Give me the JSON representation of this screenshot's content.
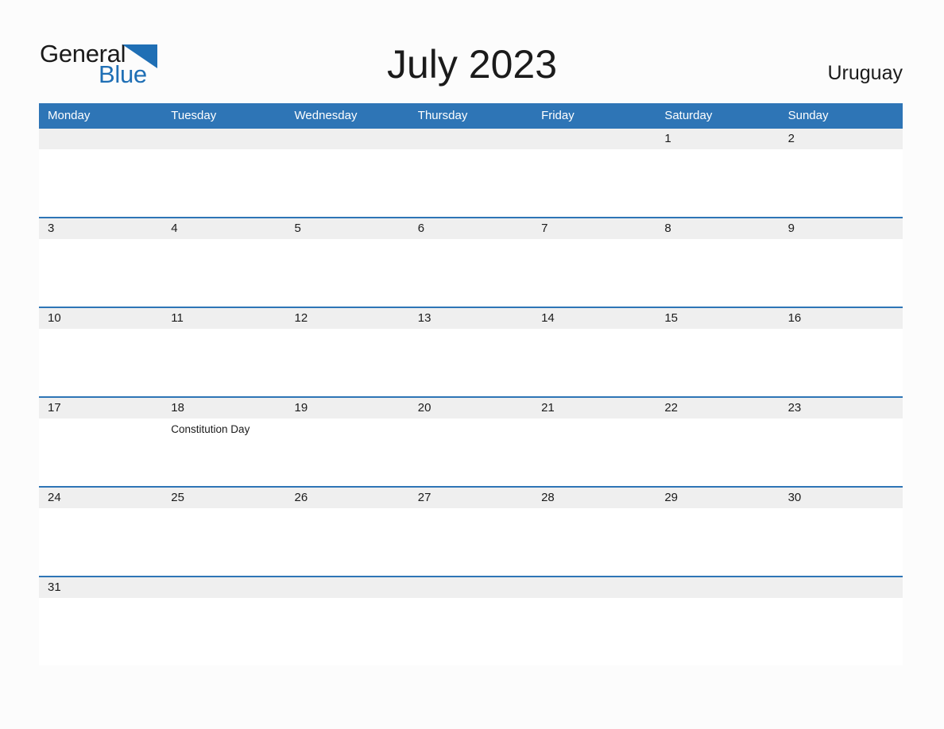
{
  "brand": {
    "name_part1": "General",
    "name_part2": "Blue",
    "triangle_color": "#1f6fb5"
  },
  "header": {
    "title": "July 2023",
    "country": "Uruguay"
  },
  "colors": {
    "header_blue": "#2e75b6",
    "day_band_gray": "#efefef",
    "page_background": "#fcfcfc",
    "text": "#1b1b1b",
    "header_text": "#ffffff"
  },
  "calendar": {
    "weekday_headers": [
      "Monday",
      "Tuesday",
      "Wednesday",
      "Thursday",
      "Friday",
      "Saturday",
      "Sunday"
    ],
    "weeks": [
      {
        "days": [
          {
            "number": "",
            "event": ""
          },
          {
            "number": "",
            "event": ""
          },
          {
            "number": "",
            "event": ""
          },
          {
            "number": "",
            "event": ""
          },
          {
            "number": "",
            "event": ""
          },
          {
            "number": "1",
            "event": ""
          },
          {
            "number": "2",
            "event": ""
          }
        ]
      },
      {
        "days": [
          {
            "number": "3",
            "event": ""
          },
          {
            "number": "4",
            "event": ""
          },
          {
            "number": "5",
            "event": ""
          },
          {
            "number": "6",
            "event": ""
          },
          {
            "number": "7",
            "event": ""
          },
          {
            "number": "8",
            "event": ""
          },
          {
            "number": "9",
            "event": ""
          }
        ]
      },
      {
        "days": [
          {
            "number": "10",
            "event": ""
          },
          {
            "number": "11",
            "event": ""
          },
          {
            "number": "12",
            "event": ""
          },
          {
            "number": "13",
            "event": ""
          },
          {
            "number": "14",
            "event": ""
          },
          {
            "number": "15",
            "event": ""
          },
          {
            "number": "16",
            "event": ""
          }
        ]
      },
      {
        "days": [
          {
            "number": "17",
            "event": ""
          },
          {
            "number": "18",
            "event": "Constitution Day"
          },
          {
            "number": "19",
            "event": ""
          },
          {
            "number": "20",
            "event": ""
          },
          {
            "number": "21",
            "event": ""
          },
          {
            "number": "22",
            "event": ""
          },
          {
            "number": "23",
            "event": ""
          }
        ]
      },
      {
        "days": [
          {
            "number": "24",
            "event": ""
          },
          {
            "number": "25",
            "event": ""
          },
          {
            "number": "26",
            "event": ""
          },
          {
            "number": "27",
            "event": ""
          },
          {
            "number": "28",
            "event": ""
          },
          {
            "number": "29",
            "event": ""
          },
          {
            "number": "30",
            "event": ""
          }
        ]
      },
      {
        "days": [
          {
            "number": "31",
            "event": ""
          },
          {
            "number": "",
            "event": ""
          },
          {
            "number": "",
            "event": ""
          },
          {
            "number": "",
            "event": ""
          },
          {
            "number": "",
            "event": ""
          },
          {
            "number": "",
            "event": ""
          },
          {
            "number": "",
            "event": ""
          }
        ]
      }
    ]
  }
}
